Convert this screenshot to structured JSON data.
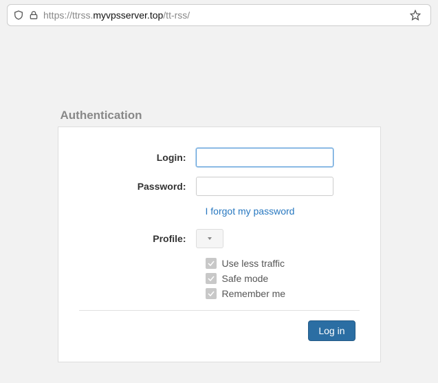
{
  "addressbar": {
    "url_prefix": "https://ttrss.",
    "url_host": "myvpsserver.top",
    "url_path": "/tt-rss/"
  },
  "panel": {
    "title": "Authentication"
  },
  "form": {
    "login_label": "Login:",
    "login_value": "",
    "password_label": "Password:",
    "password_value": "",
    "forgot_link": "I forgot my password",
    "profile_label": "Profile:",
    "profile_selected": "",
    "checkboxes": [
      {
        "label": "Use less traffic",
        "checked": true
      },
      {
        "label": "Safe mode",
        "checked": true
      },
      {
        "label": "Remember me",
        "checked": true
      }
    ],
    "submit_label": "Log in"
  }
}
